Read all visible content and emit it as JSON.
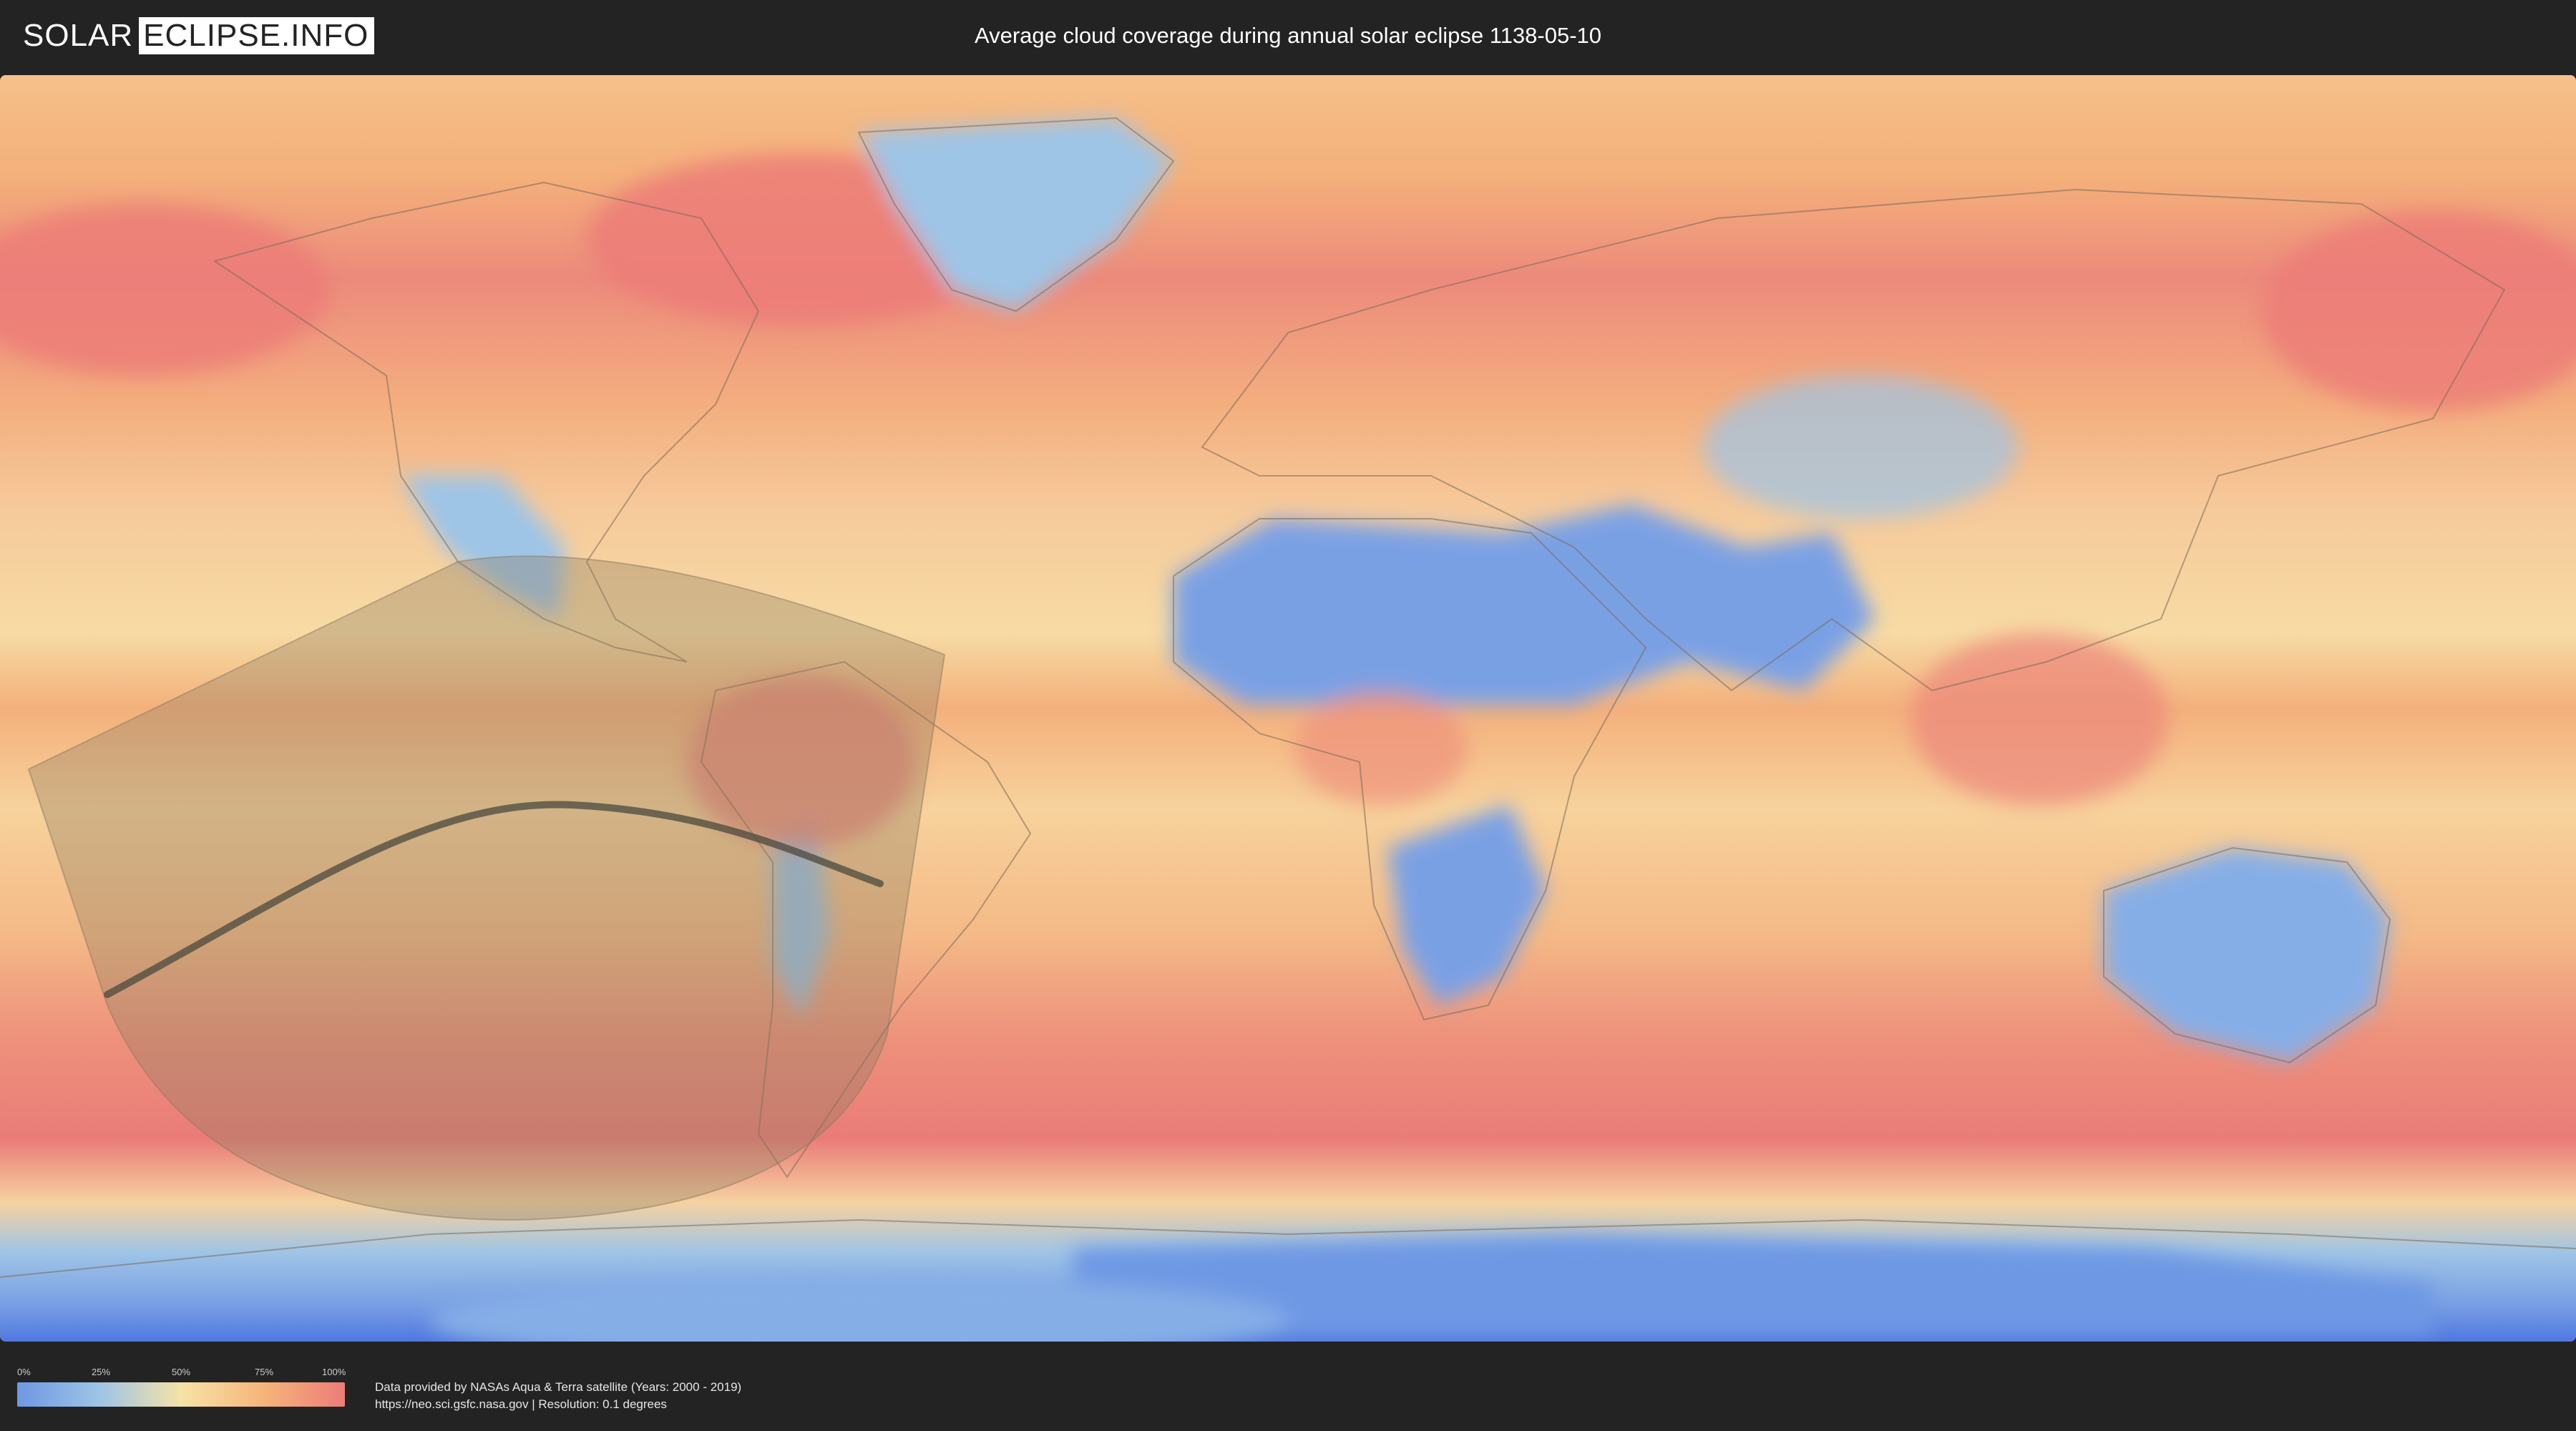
{
  "header": {
    "logo_left": "SOLAR",
    "logo_right": "ECLIPSE.INFO",
    "title": "Average cloud coverage during annual solar eclipse 1138-05-10"
  },
  "map": {
    "colors": {
      "clear": "#6e98e4",
      "low": "#9ec4e6",
      "mid": "#f6e3a6",
      "high": "#f6b57a",
      "overcast": "#ec7c78",
      "eclipse_shadow": "#8c7a5e",
      "central_line": "#4a4a3e",
      "borders": "#7a6a5a"
    }
  },
  "legend": {
    "ticks": [
      "0%",
      "25%",
      "50%",
      "75%",
      "100%"
    ]
  },
  "footer": {
    "credit_line1": "Data provided by NASAs Aqua & Terra satellite (Years: 2000 - 2019)",
    "credit_line2": "https://neo.sci.gsfc.nasa.gov | Resolution: 0.1 degrees"
  }
}
